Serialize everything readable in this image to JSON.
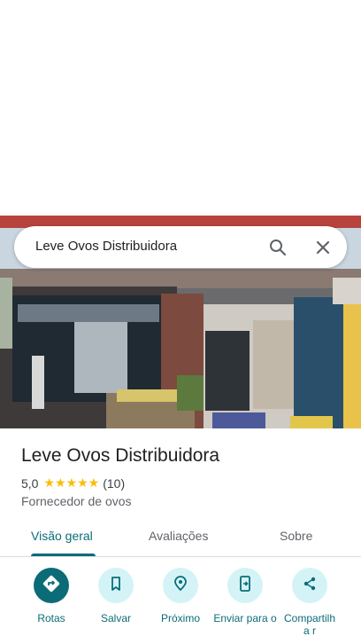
{
  "search": {
    "query": "Leve Ovos Distribuidora"
  },
  "place": {
    "name": "Leve Ovos Distribuidora",
    "rating": "5,0",
    "stars": "★★★★★",
    "review_count": "(10)",
    "category": "Fornecedor de ovos"
  },
  "tabs": [
    {
      "label": "Visão geral"
    },
    {
      "label": "Avaliações"
    },
    {
      "label": "Sobre"
    }
  ],
  "actions": [
    {
      "label": "Rotas",
      "icon": "directions-icon"
    },
    {
      "label": "Salvar",
      "icon": "bookmark-icon"
    },
    {
      "label": "Próximo",
      "icon": "nearby-icon"
    },
    {
      "label": "Enviar para o",
      "icon": "send-to-phone-icon"
    },
    {
      "label": "Compartilha r",
      "icon": "share-icon"
    }
  ],
  "colors": {
    "accent": "#0b6c78",
    "action_bg": "#d4f3f7",
    "star": "#fbbc04"
  }
}
